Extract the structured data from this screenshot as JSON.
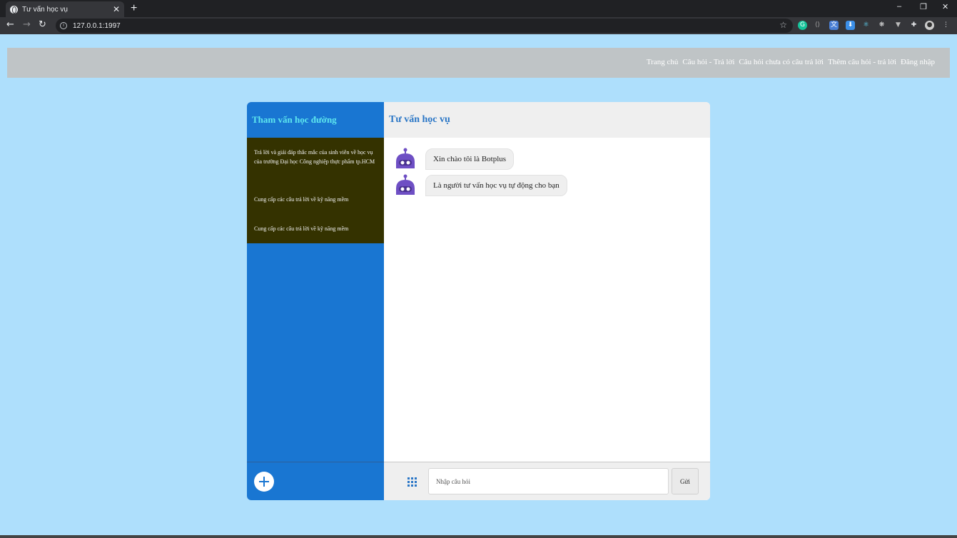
{
  "browser": {
    "tab_title": "Tư vấn học vụ",
    "url": "127.0.0.1:1997"
  },
  "nav": {
    "items": [
      "Trang chủ",
      "Câu hỏi - Trả lời",
      "Câu hỏi chưa có câu trả lời",
      "Thêm câu hỏi - trả lời",
      "Đăng nhập"
    ]
  },
  "sidebar": {
    "title": "Tham vấn học đường",
    "items": [
      "Trả lời và giải đáp thắc mắc của sinh viên về học vụ của trường Đại học Công nghiệp thực phẩm tp.HCM",
      "Cung cấp các câu trả lời về kỹ năng mềm",
      "Cung cấp các câu trả lời về kỹ năng mềm"
    ]
  },
  "chat": {
    "title": "Tư vấn học vụ",
    "messages": [
      "Xin chào tôi là Botplus",
      "Là người tư vấn học vụ tự động cho bạn"
    ],
    "input_placeholder": "Nhập câu hỏi",
    "send_label": "Gửi"
  },
  "colors": {
    "page_bg": "#aedffc",
    "sidebar_bg": "#1976d2",
    "sidebar_list_bg": "#343200",
    "title_accent": "#2a76c6",
    "bot_purple": "#6e4fc4"
  }
}
